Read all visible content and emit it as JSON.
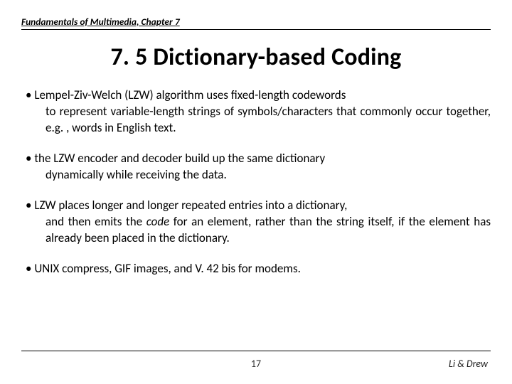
{
  "header": {
    "text": "Fundamentals of Multimedia, Chapter 7"
  },
  "title": "7. 5 Dictionary-based Coding",
  "bullets": [
    {
      "first": "Lempel-Ziv-Welch (LZW) algorithm uses fixed-length codewords",
      "rest": "to represent variable-length strings of symbols/characters that commonly occur together, e.g. , words in English text."
    },
    {
      "first": "the LZW encoder and decoder build up the same dictionary",
      "rest": "dynamically while receiving the data."
    },
    {
      "first": "LZW places longer and longer repeated entries into a dictionary,",
      "rest_pre": "and then emits the ",
      "rest_em": "code",
      "rest_post": " for an element, rather than the string itself, if the element has already been placed in the dictionary."
    },
    {
      "first": "UNIX compress, GIF images, and V. 42 bis for modems.",
      "rest": ""
    }
  ],
  "footer": {
    "page": "17",
    "right": "Li & Drew"
  }
}
